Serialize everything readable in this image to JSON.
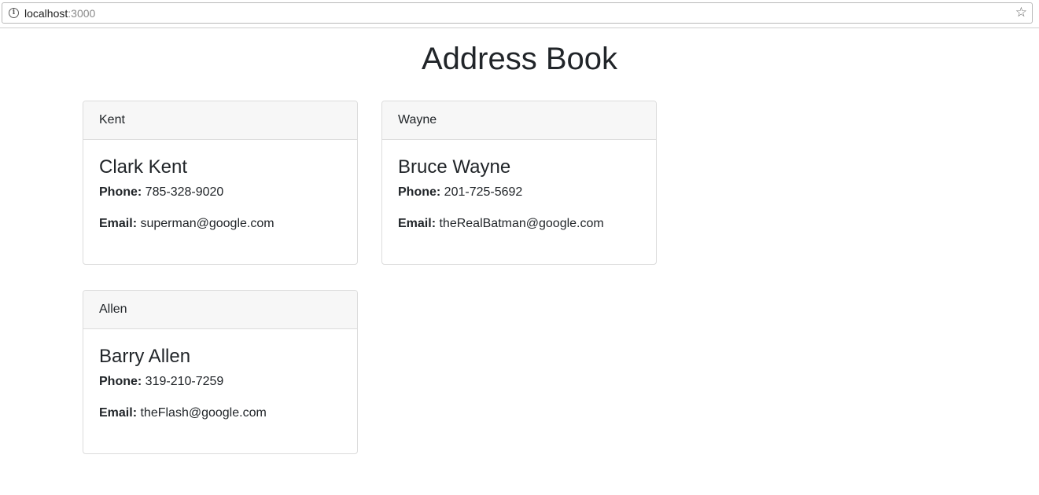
{
  "browser": {
    "url_host": "localhost",
    "url_port": ":3000",
    "info_icon_glyph": "i",
    "star_icon_glyph": "☆"
  },
  "page": {
    "title": "Address Book"
  },
  "labels": {
    "phone": "Phone:",
    "email": "Email:"
  },
  "contacts": [
    {
      "header": "Kent",
      "name": "Clark Kent",
      "phone": "785-328-9020",
      "email": "superman@google.com"
    },
    {
      "header": "Wayne",
      "name": "Bruce Wayne",
      "phone": "201-725-5692",
      "email": "theRealBatman@google.com"
    },
    {
      "header": "Allen",
      "name": "Barry Allen",
      "phone": "319-210-7259",
      "email": "theFlash@google.com"
    }
  ]
}
